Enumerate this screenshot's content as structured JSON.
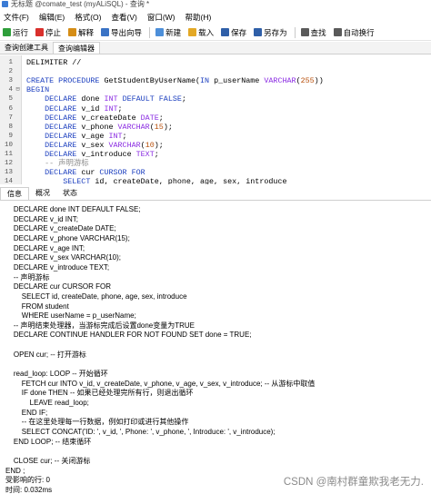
{
  "window": {
    "title": "无标题 @comate_test (myALiSQL) - 查询 *"
  },
  "menu": [
    "文件(F)",
    "编辑(E)",
    "格式(O)",
    "查看(V)",
    "窗口(W)",
    "帮助(H)"
  ],
  "toolbar": [
    {
      "label": "运行",
      "icon": "run-icon",
      "color": "#2e9e3a"
    },
    {
      "label": "停止",
      "icon": "stop-icon",
      "color": "#d9302c"
    },
    {
      "label": "解释",
      "icon": "explain-icon",
      "color": "#d58d16"
    },
    {
      "label": "导出向导",
      "icon": "export-icon",
      "color": "#3a73c5"
    },
    {
      "label": "新建",
      "icon": "new-icon",
      "color": "#4d8fd9"
    },
    {
      "label": "载入",
      "icon": "load-icon",
      "color": "#e3a825"
    },
    {
      "label": "保存",
      "icon": "save-icon",
      "color": "#2f5fa8"
    },
    {
      "label": "另存为",
      "icon": "save-as-icon",
      "color": "#2f5fa8"
    },
    {
      "label": "查找",
      "icon": "find-icon",
      "color": "#5a5a5a"
    },
    {
      "label": "自动换行",
      "icon": "word-wrap-icon",
      "color": "#5a5a5a"
    }
  ],
  "doc_tabs": [
    "查询创建工具",
    "查询编辑器"
  ],
  "editor_lines": [
    {
      "n": "1",
      "fold": "",
      "tokens": [
        {
          "t": "DELIMITER //",
          "c": ""
        }
      ]
    },
    {
      "n": "2",
      "fold": "",
      "tokens": []
    },
    {
      "n": "3",
      "fold": "",
      "tokens": [
        {
          "t": "CREATE PROCEDURE ",
          "c": "kw"
        },
        {
          "t": "GetStudentByUserName(",
          "c": ""
        },
        {
          "t": "IN ",
          "c": "kw"
        },
        {
          "t": "p_userName ",
          "c": ""
        },
        {
          "t": "VARCHAR",
          "c": "ty"
        },
        {
          "t": "(",
          "c": ""
        },
        {
          "t": "255",
          "c": "nm"
        },
        {
          "t": "))",
          "c": ""
        }
      ]
    },
    {
      "n": "4",
      "fold": "⊟",
      "tokens": [
        {
          "t": "BEGIN",
          "c": "kw"
        }
      ]
    },
    {
      "n": "5",
      "fold": "",
      "tokens": [
        {
          "t": "    DECLARE ",
          "c": "kw"
        },
        {
          "t": "done ",
          "c": ""
        },
        {
          "t": "INT ",
          "c": "ty"
        },
        {
          "t": "DEFAULT FALSE",
          "c": "kw"
        },
        {
          "t": ";",
          "c": ""
        }
      ]
    },
    {
      "n": "6",
      "fold": "",
      "tokens": [
        {
          "t": "    DECLARE ",
          "c": "kw"
        },
        {
          "t": "v_id ",
          "c": ""
        },
        {
          "t": "INT",
          "c": "ty"
        },
        {
          "t": ";",
          "c": ""
        }
      ]
    },
    {
      "n": "7",
      "fold": "",
      "tokens": [
        {
          "t": "    DECLARE ",
          "c": "kw"
        },
        {
          "t": "v_createDate ",
          "c": ""
        },
        {
          "t": "DATE",
          "c": "ty"
        },
        {
          "t": ";",
          "c": ""
        }
      ]
    },
    {
      "n": "8",
      "fold": "",
      "tokens": [
        {
          "t": "    DECLARE ",
          "c": "kw"
        },
        {
          "t": "v_phone ",
          "c": ""
        },
        {
          "t": "VARCHAR",
          "c": "ty"
        },
        {
          "t": "(",
          "c": ""
        },
        {
          "t": "15",
          "c": "nm"
        },
        {
          "t": ");",
          "c": ""
        }
      ]
    },
    {
      "n": "9",
      "fold": "",
      "tokens": [
        {
          "t": "    DECLARE ",
          "c": "kw"
        },
        {
          "t": "v_age ",
          "c": ""
        },
        {
          "t": "INT",
          "c": "ty"
        },
        {
          "t": ";",
          "c": ""
        }
      ]
    },
    {
      "n": "10",
      "fold": "",
      "tokens": [
        {
          "t": "    DECLARE ",
          "c": "kw"
        },
        {
          "t": "v_sex ",
          "c": ""
        },
        {
          "t": "VARCHAR",
          "c": "ty"
        },
        {
          "t": "(",
          "c": ""
        },
        {
          "t": "10",
          "c": "nm"
        },
        {
          "t": ");",
          "c": ""
        }
      ]
    },
    {
      "n": "11",
      "fold": "",
      "tokens": [
        {
          "t": "    DECLARE ",
          "c": "kw"
        },
        {
          "t": "v_introduce ",
          "c": ""
        },
        {
          "t": "TEXT",
          "c": "ty"
        },
        {
          "t": ";",
          "c": ""
        }
      ]
    },
    {
      "n": "12",
      "fold": "",
      "tokens": [
        {
          "t": "    -- 声明游标",
          "c": "cm"
        }
      ]
    },
    {
      "n": "13",
      "fold": "",
      "tokens": [
        {
          "t": "    DECLARE ",
          "c": "kw"
        },
        {
          "t": "cur ",
          "c": ""
        },
        {
          "t": "CURSOR FOR",
          "c": "kw"
        }
      ]
    },
    {
      "n": "14",
      "fold": "",
      "tokens": [
        {
          "t": "        SELECT ",
          "c": "kw"
        },
        {
          "t": "id, createDate, phone, age, sex, introduce",
          "c": ""
        }
      ]
    }
  ],
  "result_tabs": [
    "信息",
    "概况",
    "状态"
  ],
  "output_lines": [
    "    DECLARE done INT DEFAULT FALSE;",
    "    DECLARE v_id INT;",
    "    DECLARE v_createDate DATE;",
    "    DECLARE v_phone VARCHAR(15);",
    "    DECLARE v_age INT;",
    "    DECLARE v_sex VARCHAR(10);",
    "    DECLARE v_introduce TEXT;",
    "    -- 声明游标",
    "    DECLARE cur CURSOR FOR",
    "        SELECT id, createDate, phone, age, sex, introduce",
    "        FROM student",
    "        WHERE userName = p_userName;",
    "    -- 声明结束处理器，当游标完成后设置done变量为TRUE",
    "    DECLARE CONTINUE HANDLER FOR NOT FOUND SET done = TRUE;",
    "",
    "    OPEN cur; -- 打开游标",
    "",
    "    read_loop: LOOP -- 开始循环",
    "        FETCH cur INTO v_id, v_createDate, v_phone, v_age, v_sex, v_introduce; -- 从游标中取值",
    "        IF done THEN -- 如果已经处理完所有行，则退出循环",
    "            LEAVE read_loop;",
    "        END IF;",
    "        -- 在这里处理每一行数据，例如打印或进行其他操作",
    "        SELECT CONCAT('ID: ', v_id, ', Phone: ', v_phone, ', Introduce: ', v_introduce);",
    "    END LOOP; -- 结束循环",
    "",
    "    CLOSE cur; -- 关闭游标",
    "END ;",
    "受影响的行: 0",
    "时间: 0.032ms"
  ],
  "watermark": "CSDN @南村群童欺我老无力."
}
